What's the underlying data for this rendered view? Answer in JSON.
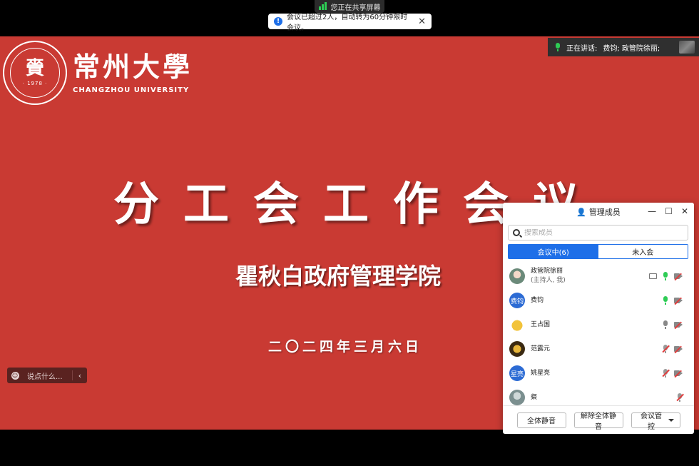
{
  "share_indicator": {
    "label": "您正在共享屏幕"
  },
  "notice": {
    "text": "会议已超过2人，自动转为60分钟限时会议。",
    "icon": "info-icon",
    "close": "✕"
  },
  "speaking": {
    "label": "正在讲话:",
    "names": "费钧; 政管院徐丽;"
  },
  "slide": {
    "logo_glyph": "賫",
    "logo_year": "· 1978 ·",
    "university_cn": "常州大學",
    "university_en": "CHANGZHOU UNIVERSITY",
    "title": "分工会工作会议",
    "subtitle": "瞿秋白政府管理学院",
    "date": "二〇二四年三月六日"
  },
  "chat": {
    "placeholder": "说点什么...",
    "collapse": "‹"
  },
  "panel": {
    "title": "管理成员",
    "window_controls": {
      "minimize": "—",
      "maximize": "☐",
      "close": "✕"
    },
    "search_placeholder": "搜索成员",
    "tabs": [
      {
        "label": "会议中(6)",
        "active": true
      },
      {
        "label": "未入会",
        "active": false
      }
    ],
    "members": [
      {
        "name": "政管院徐丽",
        "role": "(主持人, 我)",
        "avatar_text": "",
        "avatar_style": "photo",
        "sharing": true,
        "mic": "on",
        "camera": "off"
      },
      {
        "name": "费钧",
        "role": "",
        "avatar_text": "费钧",
        "avatar_style": "blue",
        "sharing": false,
        "mic": "on",
        "camera": "off"
      },
      {
        "name": "王占国",
        "role": "",
        "avatar_text": "",
        "avatar_style": "cartoon",
        "sharing": false,
        "mic": "idle",
        "camera": "off"
      },
      {
        "name": "范露元",
        "role": "",
        "avatar_text": "",
        "avatar_style": "dark",
        "sharing": false,
        "mic": "muted",
        "camera": "off"
      },
      {
        "name": "姚星亮",
        "role": "",
        "avatar_text": "星亮",
        "avatar_style": "blue",
        "sharing": false,
        "mic": "muted",
        "camera": "off"
      },
      {
        "name": "粲",
        "role": "",
        "avatar_text": "",
        "avatar_style": "photo2",
        "sharing": false,
        "mic": "muted",
        "camera": "none"
      }
    ],
    "footer": {
      "mute_all": "全体静音",
      "unmute_all": "解除全体静音",
      "meeting_control": "会议管控"
    }
  },
  "colors": {
    "slide_red": "#c93a33",
    "accent_blue": "#1e6fe8",
    "mic_green": "#2ecc55",
    "muted_red": "#e03c3c"
  }
}
